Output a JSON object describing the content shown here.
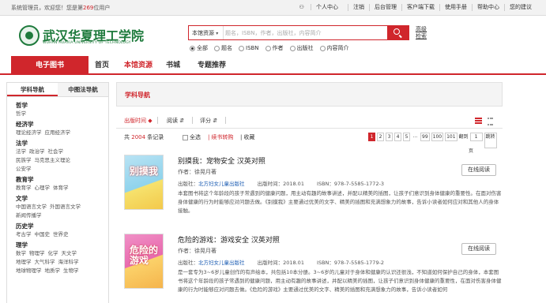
{
  "topbar": {
    "welcome_prefix": "系统管理员，欢迎您！您是第",
    "visitor_number": "269",
    "welcome_suffix": "位用户",
    "links": [
      "个人中心",
      "注销",
      "后台管理",
      "客户端下载",
      "使用手册",
      "帮助中心",
      "您的建议"
    ]
  },
  "logo": {
    "name_cn": "武汉华夏理工学院",
    "name_en": "WUHAN HUAXIA UNIVERSITY OF TECHNOLOGY"
  },
  "search": {
    "type_label": "本馆资源",
    "placeholder": "题名，ISBN，作者，出版社，内容简介",
    "advanced_label": "高级检索",
    "options": [
      "全部",
      "题名",
      "ISBN",
      "作者",
      "出版社",
      "内容简介"
    ],
    "selected": "全部"
  },
  "nav": {
    "items": [
      "电子图书",
      "首页",
      "本馆资源",
      "书城",
      "专题推荐"
    ],
    "active": "本馆资源"
  },
  "sidebar": {
    "tabs": [
      "学科导航",
      "中图法导航"
    ],
    "categories": [
      {
        "title": "哲学",
        "subs": [
          "哲学"
        ]
      },
      {
        "title": "经济学",
        "subs": [
          "理论经济学",
          "应用经济学"
        ]
      },
      {
        "title": "法学",
        "subs": [
          "法学",
          "政治学",
          "社会学",
          "民族学",
          "马克思主义理论",
          "公安学"
        ]
      },
      {
        "title": "教育学",
        "subs": [
          "教育学",
          "心理学",
          "体育学"
        ]
      },
      {
        "title": "文学",
        "subs": [
          "中国语言文学",
          "外国语言文学",
          "新闻传播学"
        ]
      },
      {
        "title": "历史学",
        "subs": [
          "考古学",
          "中国史",
          "世界史"
        ]
      },
      {
        "title": "理学",
        "subs": [
          "数学",
          "物理学",
          "化学",
          "天文学",
          "地理学",
          "大气科学",
          "海洋科学",
          "地球物理学",
          "地质学",
          "生物学"
        ]
      }
    ]
  },
  "main": {
    "heading": "学科导航",
    "sort": {
      "time": "出版时间",
      "reads": "阅读",
      "rating": "评分"
    },
    "toolbar": {
      "count_prefix": "共",
      "count": "2004",
      "count_suffix": "条记录",
      "select_all": "全选",
      "borrow": "续书转购",
      "favorite": "收藏"
    },
    "pager": {
      "pages": [
        "1",
        "2",
        "3",
        "4",
        "5",
        "...",
        "99",
        "100",
        "101"
      ],
      "current": "1",
      "goto_label": "翻到",
      "goto_value": "1",
      "page_unit": "页",
      "go_label": "跳转"
    }
  },
  "books": [
    {
      "cover_text": "别摸我",
      "title": "别摸我：宠物安全  汉英对照",
      "author": "作者：徐晃月著",
      "publisher_label": "出版社：",
      "publisher": "北方妇女儿童出版社",
      "date": "出版时间：2018.01",
      "isbn": "ISBN：978-7-5585-1772-3",
      "desc": "本套图书将这个年龄段的孩子常遇到的健康问题，用主动有趣的故事讲述，并配以精美的插图，让孩子们意识到身体健康的重要性。在面对伤害身体健康的行为时能够应对问题去做。《别摸我》主要通过优美的文字、精美的插图和充满想象力的故事，告诉小读者如何应对和其他人的身体接触。",
      "read_label": "在线阅读"
    },
    {
      "cover_text": "危险的游戏",
      "title": "危险的游戏：游戏安全  汉英对照",
      "author": "作者：徐晃月著",
      "publisher_label": "出版社：",
      "publisher": "北方妇女儿童出版社",
      "date": "出版时间：2018.01",
      "isbn": "ISBN：978-7-5585-1779-2",
      "desc": "是一套专为3~6岁儿童创作的有声绘本，共包括10本分册。3~6岁的儿童对于身体和健康的认识还很浅，不知道如何保护自己的身体，本套图书将这个年龄段的孩子常遇到的健康问题，用主动有趣的故事讲述，并配以精美的插图，让孩子们意识到身体健康的重要性，在面对伤害身体健康的行为时能够应对问题去做。《危险的游戏》主要通过优美的文字、精美的插图和充满想象力的故事，告诉小读者如何",
      "read_label": "在线阅读"
    }
  ]
}
